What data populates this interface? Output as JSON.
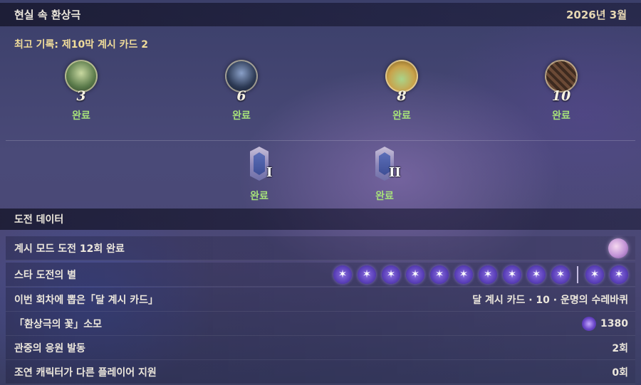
{
  "header": {
    "title": "현실 속 환상극",
    "month": "2026년 3월"
  },
  "record": {
    "text": "최고 기록: 제10막 계시 카드 2"
  },
  "floors": [
    {
      "mark": "3",
      "status": "완료",
      "icon": "green-feathered-boss-icon",
      "color": "#5a7a4a"
    },
    {
      "mark": "6",
      "status": "완료",
      "icon": "dark-armored-boss-icon",
      "color": "#2d3a55"
    },
    {
      "mark": "8",
      "status": "완료",
      "icon": "golden-fungus-boss-icon",
      "color": "#c9a24a"
    },
    {
      "mark": "10",
      "status": "완료",
      "icon": "brown-construct-boss-icon",
      "color": "#6b4a36"
    }
  ],
  "cards": [
    {
      "numeral": "I",
      "status": "완료"
    },
    {
      "numeral": "II",
      "status": "완료"
    }
  ],
  "section": {
    "title": "도전 데이터"
  },
  "rows": {
    "challenge_mode": {
      "label": "계시 모드 도전 12회 완료"
    },
    "stars": {
      "label": "스타 도전의 별",
      "earned_before_divider": 10,
      "earned_after_divider": 2
    },
    "draw": {
      "label": "이번 회차에 뽑은「달 계시 카드」",
      "value": "달 계시 카드 · 10 · 운명의 수레바퀴"
    },
    "flower": {
      "label": "「환상극의 꽃」소모",
      "value": "1380"
    },
    "cheer": {
      "label": "관중의 응원 발동",
      "value": "2회"
    },
    "support": {
      "label": "조연 캐릭터가 다른 플레이어 지원",
      "value": "0회"
    }
  },
  "colors": {
    "accent_gold": "#f0dc9a",
    "done_green": "#a6e07a",
    "star_purple": "#6a4ad0"
  }
}
